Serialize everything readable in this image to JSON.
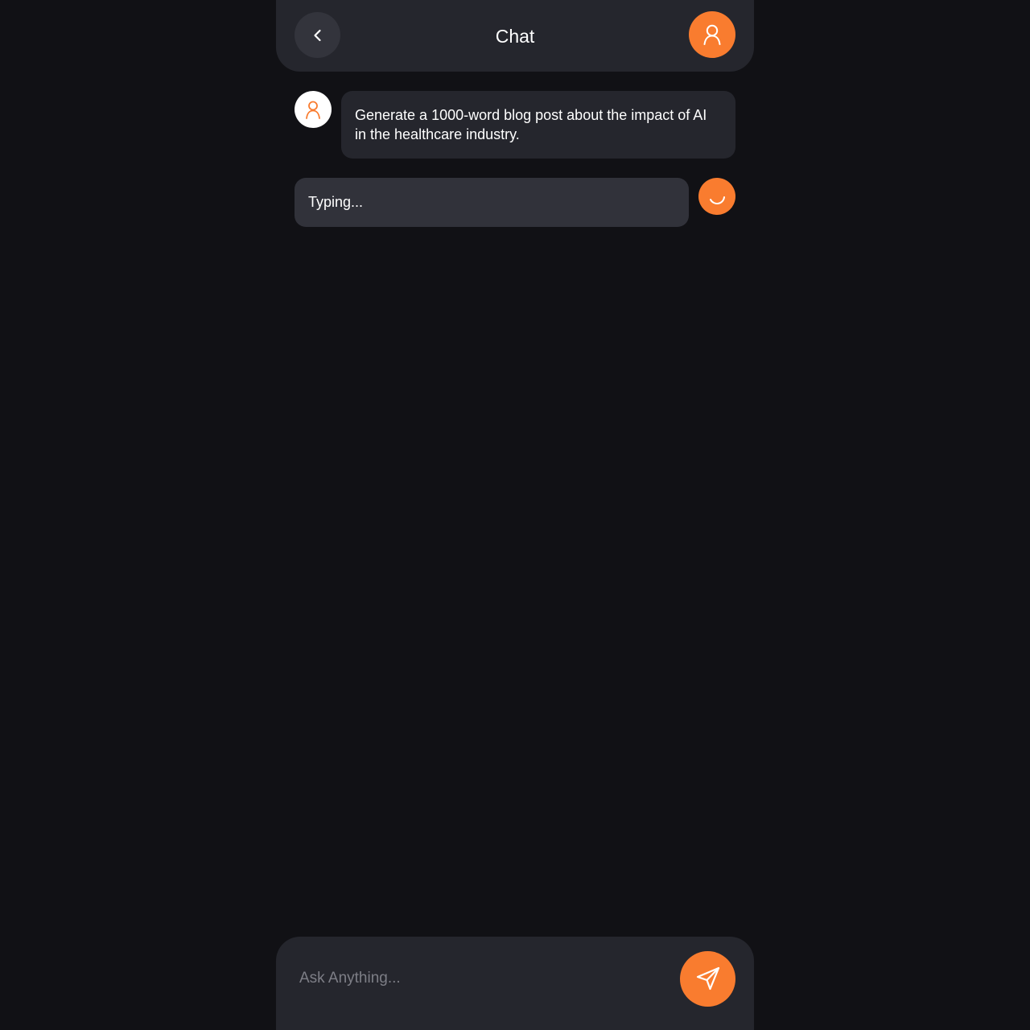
{
  "colors": {
    "background": "#111115",
    "surface": "#25262d",
    "accent": "#f97c2f",
    "text": "#ffffff",
    "placeholder": "#7d7e86"
  },
  "header": {
    "title": "Chat",
    "back_icon": "chevron-left-icon",
    "profile_icon": "user-icon"
  },
  "messages": [
    {
      "sender": "user",
      "avatar_icon": "user-icon",
      "text": "Generate a 1000-word blog post about the impact of AI in the healthcare industry."
    },
    {
      "sender": "assistant",
      "avatar_icon": "spinner-icon",
      "text": "Typing..."
    }
  ],
  "composer": {
    "placeholder": "Ask Anything...",
    "value": "",
    "send_icon": "send-icon"
  }
}
